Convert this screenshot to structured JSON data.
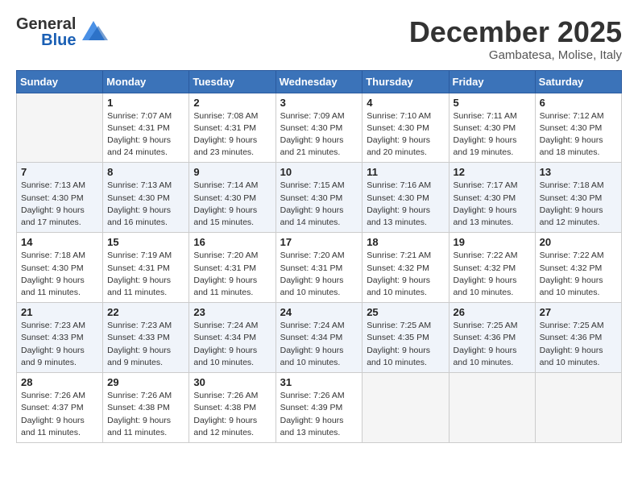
{
  "logo": {
    "text_general": "General",
    "text_blue": "Blue"
  },
  "title": "December 2025",
  "subtitle": "Gambatesa, Molise, Italy",
  "days_of_week": [
    "Sunday",
    "Monday",
    "Tuesday",
    "Wednesday",
    "Thursday",
    "Friday",
    "Saturday"
  ],
  "weeks": [
    [
      {
        "day": "",
        "sunrise": "",
        "sunset": "",
        "daylight": ""
      },
      {
        "day": "1",
        "sunrise": "Sunrise: 7:07 AM",
        "sunset": "Sunset: 4:31 PM",
        "daylight": "Daylight: 9 hours and 24 minutes."
      },
      {
        "day": "2",
        "sunrise": "Sunrise: 7:08 AM",
        "sunset": "Sunset: 4:31 PM",
        "daylight": "Daylight: 9 hours and 23 minutes."
      },
      {
        "day": "3",
        "sunrise": "Sunrise: 7:09 AM",
        "sunset": "Sunset: 4:30 PM",
        "daylight": "Daylight: 9 hours and 21 minutes."
      },
      {
        "day": "4",
        "sunrise": "Sunrise: 7:10 AM",
        "sunset": "Sunset: 4:30 PM",
        "daylight": "Daylight: 9 hours and 20 minutes."
      },
      {
        "day": "5",
        "sunrise": "Sunrise: 7:11 AM",
        "sunset": "Sunset: 4:30 PM",
        "daylight": "Daylight: 9 hours and 19 minutes."
      },
      {
        "day": "6",
        "sunrise": "Sunrise: 7:12 AM",
        "sunset": "Sunset: 4:30 PM",
        "daylight": "Daylight: 9 hours and 18 minutes."
      }
    ],
    [
      {
        "day": "7",
        "sunrise": "Sunrise: 7:13 AM",
        "sunset": "Sunset: 4:30 PM",
        "daylight": "Daylight: 9 hours and 17 minutes."
      },
      {
        "day": "8",
        "sunrise": "Sunrise: 7:13 AM",
        "sunset": "Sunset: 4:30 PM",
        "daylight": "Daylight: 9 hours and 16 minutes."
      },
      {
        "day": "9",
        "sunrise": "Sunrise: 7:14 AM",
        "sunset": "Sunset: 4:30 PM",
        "daylight": "Daylight: 9 hours and 15 minutes."
      },
      {
        "day": "10",
        "sunrise": "Sunrise: 7:15 AM",
        "sunset": "Sunset: 4:30 PM",
        "daylight": "Daylight: 9 hours and 14 minutes."
      },
      {
        "day": "11",
        "sunrise": "Sunrise: 7:16 AM",
        "sunset": "Sunset: 4:30 PM",
        "daylight": "Daylight: 9 hours and 13 minutes."
      },
      {
        "day": "12",
        "sunrise": "Sunrise: 7:17 AM",
        "sunset": "Sunset: 4:30 PM",
        "daylight": "Daylight: 9 hours and 13 minutes."
      },
      {
        "day": "13",
        "sunrise": "Sunrise: 7:18 AM",
        "sunset": "Sunset: 4:30 PM",
        "daylight": "Daylight: 9 hours and 12 minutes."
      }
    ],
    [
      {
        "day": "14",
        "sunrise": "Sunrise: 7:18 AM",
        "sunset": "Sunset: 4:30 PM",
        "daylight": "Daylight: 9 hours and 11 minutes."
      },
      {
        "day": "15",
        "sunrise": "Sunrise: 7:19 AM",
        "sunset": "Sunset: 4:31 PM",
        "daylight": "Daylight: 9 hours and 11 minutes."
      },
      {
        "day": "16",
        "sunrise": "Sunrise: 7:20 AM",
        "sunset": "Sunset: 4:31 PM",
        "daylight": "Daylight: 9 hours and 11 minutes."
      },
      {
        "day": "17",
        "sunrise": "Sunrise: 7:20 AM",
        "sunset": "Sunset: 4:31 PM",
        "daylight": "Daylight: 9 hours and 10 minutes."
      },
      {
        "day": "18",
        "sunrise": "Sunrise: 7:21 AM",
        "sunset": "Sunset: 4:32 PM",
        "daylight": "Daylight: 9 hours and 10 minutes."
      },
      {
        "day": "19",
        "sunrise": "Sunrise: 7:22 AM",
        "sunset": "Sunset: 4:32 PM",
        "daylight": "Daylight: 9 hours and 10 minutes."
      },
      {
        "day": "20",
        "sunrise": "Sunrise: 7:22 AM",
        "sunset": "Sunset: 4:32 PM",
        "daylight": "Daylight: 9 hours and 10 minutes."
      }
    ],
    [
      {
        "day": "21",
        "sunrise": "Sunrise: 7:23 AM",
        "sunset": "Sunset: 4:33 PM",
        "daylight": "Daylight: 9 hours and 9 minutes."
      },
      {
        "day": "22",
        "sunrise": "Sunrise: 7:23 AM",
        "sunset": "Sunset: 4:33 PM",
        "daylight": "Daylight: 9 hours and 9 minutes."
      },
      {
        "day": "23",
        "sunrise": "Sunrise: 7:24 AM",
        "sunset": "Sunset: 4:34 PM",
        "daylight": "Daylight: 9 hours and 10 minutes."
      },
      {
        "day": "24",
        "sunrise": "Sunrise: 7:24 AM",
        "sunset": "Sunset: 4:34 PM",
        "daylight": "Daylight: 9 hours and 10 minutes."
      },
      {
        "day": "25",
        "sunrise": "Sunrise: 7:25 AM",
        "sunset": "Sunset: 4:35 PM",
        "daylight": "Daylight: 9 hours and 10 minutes."
      },
      {
        "day": "26",
        "sunrise": "Sunrise: 7:25 AM",
        "sunset": "Sunset: 4:36 PM",
        "daylight": "Daylight: 9 hours and 10 minutes."
      },
      {
        "day": "27",
        "sunrise": "Sunrise: 7:25 AM",
        "sunset": "Sunset: 4:36 PM",
        "daylight": "Daylight: 9 hours and 10 minutes."
      }
    ],
    [
      {
        "day": "28",
        "sunrise": "Sunrise: 7:26 AM",
        "sunset": "Sunset: 4:37 PM",
        "daylight": "Daylight: 9 hours and 11 minutes."
      },
      {
        "day": "29",
        "sunrise": "Sunrise: 7:26 AM",
        "sunset": "Sunset: 4:38 PM",
        "daylight": "Daylight: 9 hours and 11 minutes."
      },
      {
        "day": "30",
        "sunrise": "Sunrise: 7:26 AM",
        "sunset": "Sunset: 4:38 PM",
        "daylight": "Daylight: 9 hours and 12 minutes."
      },
      {
        "day": "31",
        "sunrise": "Sunrise: 7:26 AM",
        "sunset": "Sunset: 4:39 PM",
        "daylight": "Daylight: 9 hours and 13 minutes."
      },
      {
        "day": "",
        "sunrise": "",
        "sunset": "",
        "daylight": ""
      },
      {
        "day": "",
        "sunrise": "",
        "sunset": "",
        "daylight": ""
      },
      {
        "day": "",
        "sunrise": "",
        "sunset": "",
        "daylight": ""
      }
    ]
  ]
}
